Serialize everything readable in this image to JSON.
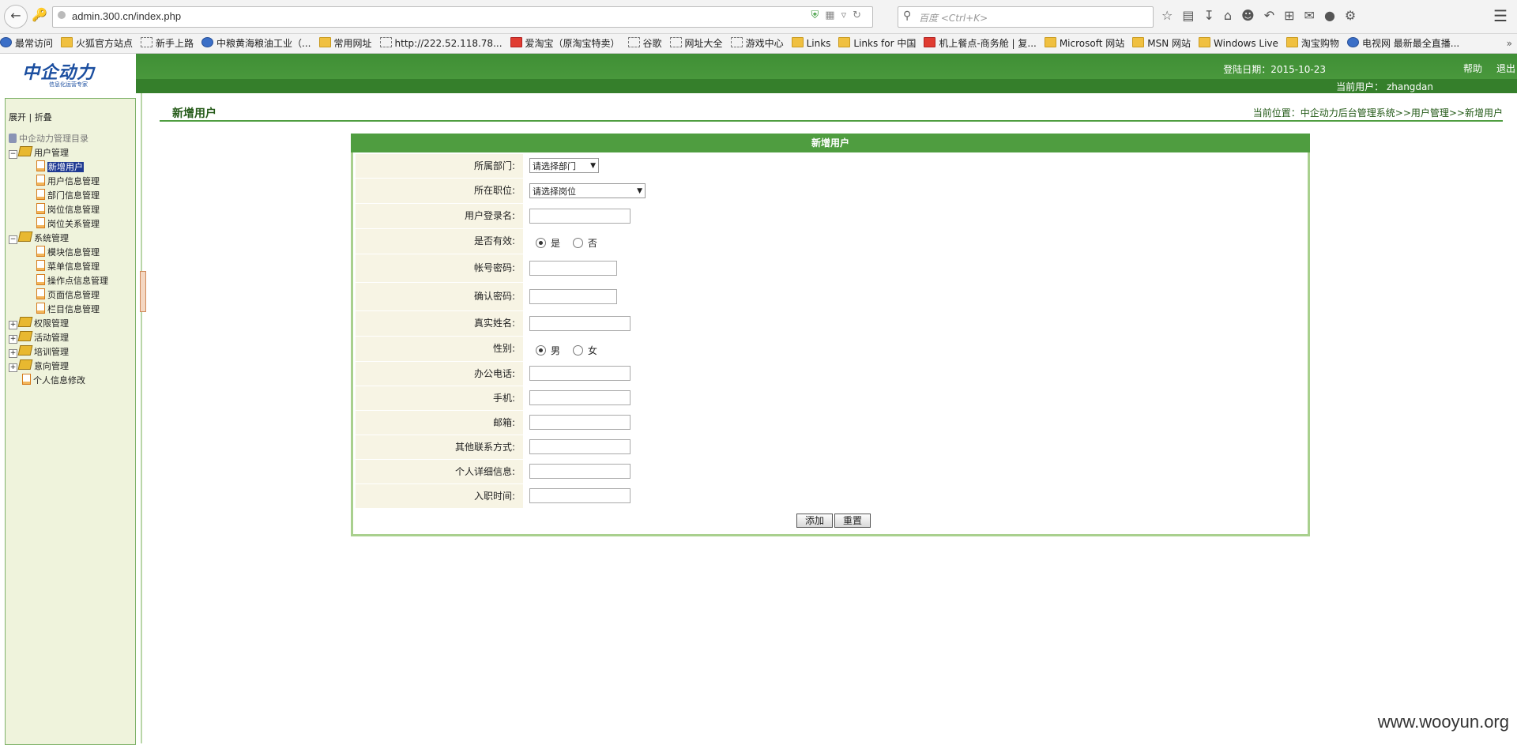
{
  "browser": {
    "url": "admin.300.cn/index.php",
    "search_placeholder": "百度 <Ctrl+K>",
    "bookmarks": [
      {
        "label": "最常访问",
        "icon": "blue"
      },
      {
        "label": "火狐官方站点",
        "icon": "folder"
      },
      {
        "label": "新手上路",
        "icon": "dashed"
      },
      {
        "label": "中粮黄海粮油工业（...",
        "icon": "blue"
      },
      {
        "label": "常用网址",
        "icon": "folder"
      },
      {
        "label": "http://222.52.118.78...",
        "icon": "dashed"
      },
      {
        "label": "爱淘宝（原淘宝特卖）",
        "icon": "red"
      },
      {
        "label": "谷歌",
        "icon": "dashed"
      },
      {
        "label": "网址大全",
        "icon": "dashed"
      },
      {
        "label": "游戏中心",
        "icon": "dashed"
      },
      {
        "label": "Links",
        "icon": "folder"
      },
      {
        "label": "Links for 中国",
        "icon": "folder"
      },
      {
        "label": "机上餐点-商务舱 | 复...",
        "icon": "red"
      },
      {
        "label": "Microsoft 网站",
        "icon": "folder"
      },
      {
        "label": "MSN 网站",
        "icon": "folder"
      },
      {
        "label": "Windows Live",
        "icon": "folder"
      },
      {
        "label": "淘宝购物",
        "icon": "folder"
      },
      {
        "label": "电视网 最新最全直播...",
        "icon": "blue"
      }
    ],
    "more": "»"
  },
  "header": {
    "logo_text": "中企动力",
    "logo_sub": "信息化运营专家",
    "login_date": "登陆日期：2015-10-23",
    "help": "帮助",
    "logout": "退出",
    "current_user": "当前用户： zhangdan"
  },
  "sidebar": {
    "expand": "展开",
    "separator": "|",
    "collapse": "折叠",
    "root": "中企动力管理目录",
    "groups": [
      {
        "label": "用户管理",
        "open": true,
        "items": [
          "新增用户",
          "用户信息管理",
          "部门信息管理",
          "岗位信息管理",
          "岗位关系管理"
        ]
      },
      {
        "label": "系统管理",
        "open": true,
        "items": [
          "模块信息管理",
          "菜单信息管理",
          "操作点信息管理",
          "页面信息管理",
          "栏目信息管理"
        ]
      },
      {
        "label": "权限管理",
        "open": false,
        "items": []
      },
      {
        "label": "活动管理",
        "open": false,
        "items": []
      },
      {
        "label": "培训管理",
        "open": false,
        "items": []
      },
      {
        "label": "意向管理",
        "open": false,
        "items": []
      }
    ],
    "personal": "个人信息修改",
    "selected": "新增用户"
  },
  "main": {
    "page_title": "新增用户",
    "breadcrumb": "当前位置：中企动力后台管理系统>>用户管理>>新增用户",
    "panel_title": "新增用户",
    "fields": {
      "dept_label": "所属部门:",
      "dept_value": "请选择部门",
      "post_label": "所在职位:",
      "post_value": "请选择岗位",
      "login_label": "用户登录名:",
      "valid_label": "是否有效:",
      "valid_yes": "是",
      "valid_no": "否",
      "pwd_label": "帐号密码:",
      "pwd2_label": "确认密码:",
      "realname_label": "真实姓名:",
      "gender_label": "性别:",
      "gender_male": "男",
      "gender_female": "女",
      "office_label": "办公电话:",
      "mobile_label": "手机:",
      "email_label": "邮箱:",
      "other_label": "其他联系方式:",
      "detail_label": "个人详细信息:",
      "join_label": "入职时间:"
    },
    "add_button": "添加",
    "reset_button": "重置"
  },
  "watermark": "www.wooyun.org"
}
